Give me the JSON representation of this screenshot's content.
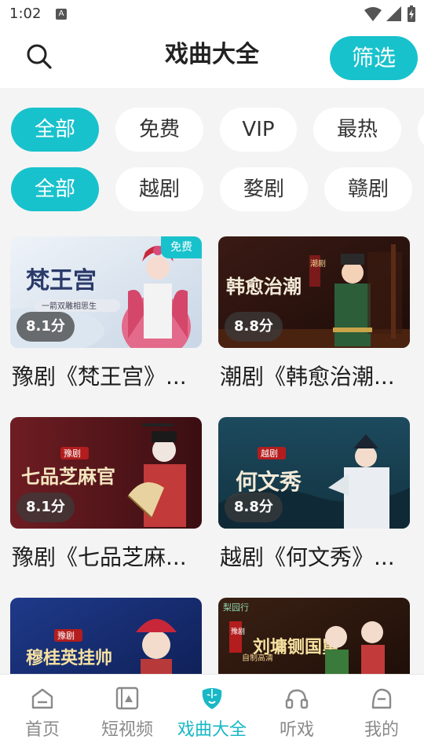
{
  "status_bar": {
    "time": "1:02",
    "notification_icon": "A"
  },
  "header": {
    "title": "戏曲大全",
    "filter_label": "筛选"
  },
  "price_filters": [
    {
      "label": "全部",
      "active": true
    },
    {
      "label": "免费",
      "active": false
    },
    {
      "label": "VIP",
      "active": false
    },
    {
      "label": "最热",
      "active": false
    }
  ],
  "genre_filters": [
    {
      "label": "全部",
      "active": true
    },
    {
      "label": "越剧",
      "active": false
    },
    {
      "label": "婺剧",
      "active": false
    },
    {
      "label": "赣剧",
      "active": false
    }
  ],
  "items": [
    {
      "title": "豫剧《梵王宫》...",
      "rating": "8.1分",
      "badge": "免费",
      "poster_text": "梵王宫",
      "poster_subtext": "一箭双雕相思生"
    },
    {
      "title": "潮剧《韩愈治潮...",
      "rating": "8.8分",
      "badge": "",
      "poster_text": "韩愈治潮",
      "poster_tag": "潮剧"
    },
    {
      "title": "豫剧《七品芝麻...",
      "rating": "8.1分",
      "badge": "",
      "poster_text": "七品芝麻官",
      "poster_tag": "豫剧"
    },
    {
      "title": "越剧《何文秀》...",
      "rating": "8.8分",
      "badge": "",
      "poster_text": "何文秀",
      "poster_tag": "越剧"
    },
    {
      "title": "",
      "rating": "",
      "badge": "",
      "poster_text": "穆桂英挂帅",
      "poster_tag": "豫剧"
    },
    {
      "title": "",
      "rating": "",
      "badge": "",
      "poster_text": "刘墉铡国舅",
      "poster_tag": "豫剧",
      "poster_brand": "梨园行",
      "poster_subtext": "自制高清"
    }
  ],
  "bottom_nav": [
    {
      "label": "首页",
      "icon": "home-icon",
      "active": false
    },
    {
      "label": "短视频",
      "icon": "short-video-icon",
      "active": false
    },
    {
      "label": "戏曲大全",
      "icon": "opera-mask-icon",
      "active": true
    },
    {
      "label": "听戏",
      "icon": "headphones-icon",
      "active": false
    },
    {
      "label": "我的",
      "icon": "profile-icon",
      "active": false
    }
  ],
  "colors": {
    "accent": "#18c2cc",
    "background": "#f4f4f4"
  }
}
